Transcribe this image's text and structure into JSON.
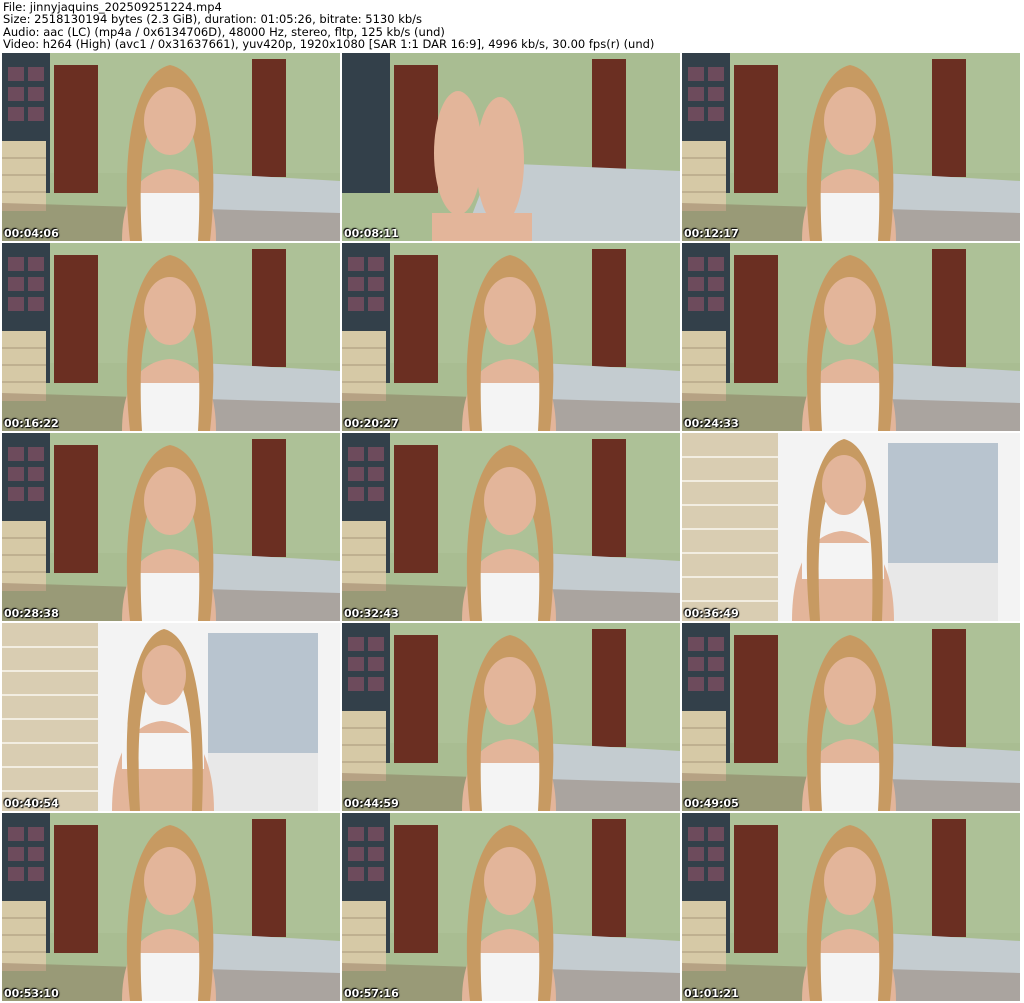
{
  "header": {
    "file": "File: jinnyjaquins_202509251224.mp4",
    "size": "Size: 2518130194 bytes (2.3 GiB), duration: 01:05:26, bitrate: 5130 kb/s",
    "audio": "Audio: aac (LC) (mp4a / 0x6134706D), 48000 Hz, stereo, fltp, 125 kb/s (und)",
    "video": "Video: h264 (High) (avc1 / 0x31637661), yuv420p, 1920x1080 [SAR 1:1 DAR 16:9], 4996 kb/s, 30.00 fps(r) (und)"
  },
  "thumbnails": [
    {
      "time": "00:04:06",
      "scene": "room"
    },
    {
      "time": "00:08:11",
      "scene": "feet"
    },
    {
      "time": "00:12:17",
      "scene": "room"
    },
    {
      "time": "00:16:22",
      "scene": "room"
    },
    {
      "time": "00:20:27",
      "scene": "room"
    },
    {
      "time": "00:24:33",
      "scene": "room"
    },
    {
      "time": "00:28:38",
      "scene": "room"
    },
    {
      "time": "00:32:43",
      "scene": "room"
    },
    {
      "time": "00:36:49",
      "scene": "balcony"
    },
    {
      "time": "00:40:54",
      "scene": "balcony"
    },
    {
      "time": "00:44:59",
      "scene": "room"
    },
    {
      "time": "00:49:05",
      "scene": "room"
    },
    {
      "time": "00:53:10",
      "scene": "room"
    },
    {
      "time": "00:57:16",
      "scene": "room"
    },
    {
      "time": "01:01:21",
      "scene": "room"
    }
  ],
  "colors": {
    "wall": "#a9bd92",
    "door": "#6b2f22",
    "bed": "#c4ccd0",
    "hair": "#c79a62",
    "skin": "#e3b59a",
    "top": "#f4f4f4",
    "brick": "#d9cdb2",
    "sky": "#dfe6ec"
  }
}
